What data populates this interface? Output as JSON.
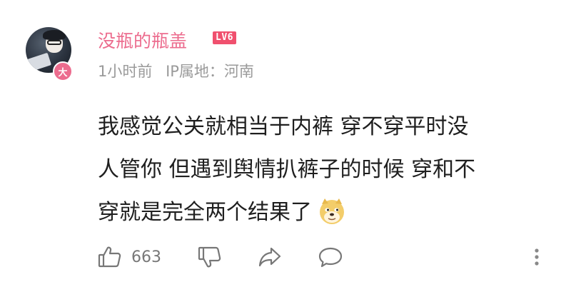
{
  "user": {
    "name": "没瓶的瓶盖",
    "level": "LV6",
    "avatar_badge": "大"
  },
  "meta": {
    "time": "1小时前",
    "ip_location": "IP属地：河南"
  },
  "comment": {
    "lines": [
      "我感觉公关就相当于内裤 穿不穿平时没",
      "人管你 但遇到舆情扒裤子的时候 穿和不",
      "穿就是完全两个结果了"
    ],
    "emoji": "doge"
  },
  "actions": {
    "like_count": "663",
    "like_icon": "thumbs-up-icon",
    "dislike_icon": "thumbs-down-icon",
    "share_icon": "share-icon",
    "reply_icon": "comment-bubble-icon",
    "more_icon": "more-vertical-icon"
  },
  "colors": {
    "username": "#ec6c8e",
    "level_badge": "#f0506e",
    "meta_text": "#9a9a9a",
    "body_text": "#1f1f1f",
    "icon": "#777777"
  }
}
